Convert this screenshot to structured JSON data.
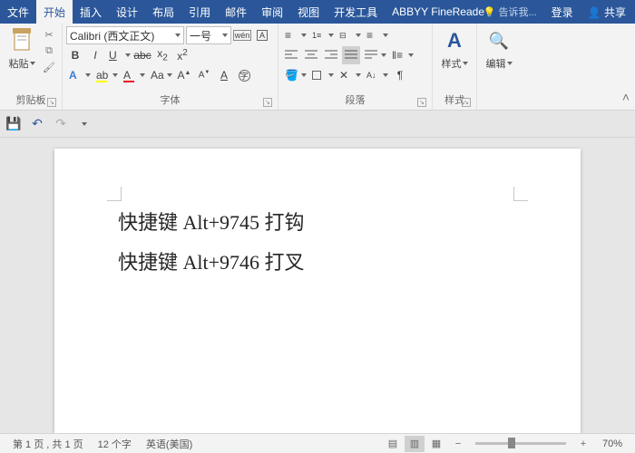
{
  "tabs": {
    "file": "文件",
    "home": "开始",
    "insert": "插入",
    "design": "设计",
    "layout": "布局",
    "references": "引用",
    "mailings": "邮件",
    "review": "审阅",
    "view": "视图",
    "developer": "开发工具",
    "abbyy": "ABBYY FineReade"
  },
  "title_right": {
    "tell_me": "告诉我...",
    "login": "登录",
    "share": "共享"
  },
  "clipboard": {
    "paste": "粘贴",
    "group": "剪贴板"
  },
  "font": {
    "name": "Calibri (西文正文)",
    "size": "一号",
    "group": "字体"
  },
  "paragraph": {
    "group": "段落"
  },
  "styles": {
    "btn": "样式",
    "group": "样式"
  },
  "editing": {
    "btn": "编辑"
  },
  "document": {
    "line1": "快捷键 Alt+9745  打钩",
    "line2": "快捷键 Alt+9746  打叉"
  },
  "status": {
    "page": "第 1 页 , 共 1 页",
    "words": "12 个字",
    "lang": "英语(美国)",
    "zoom": "70%"
  }
}
